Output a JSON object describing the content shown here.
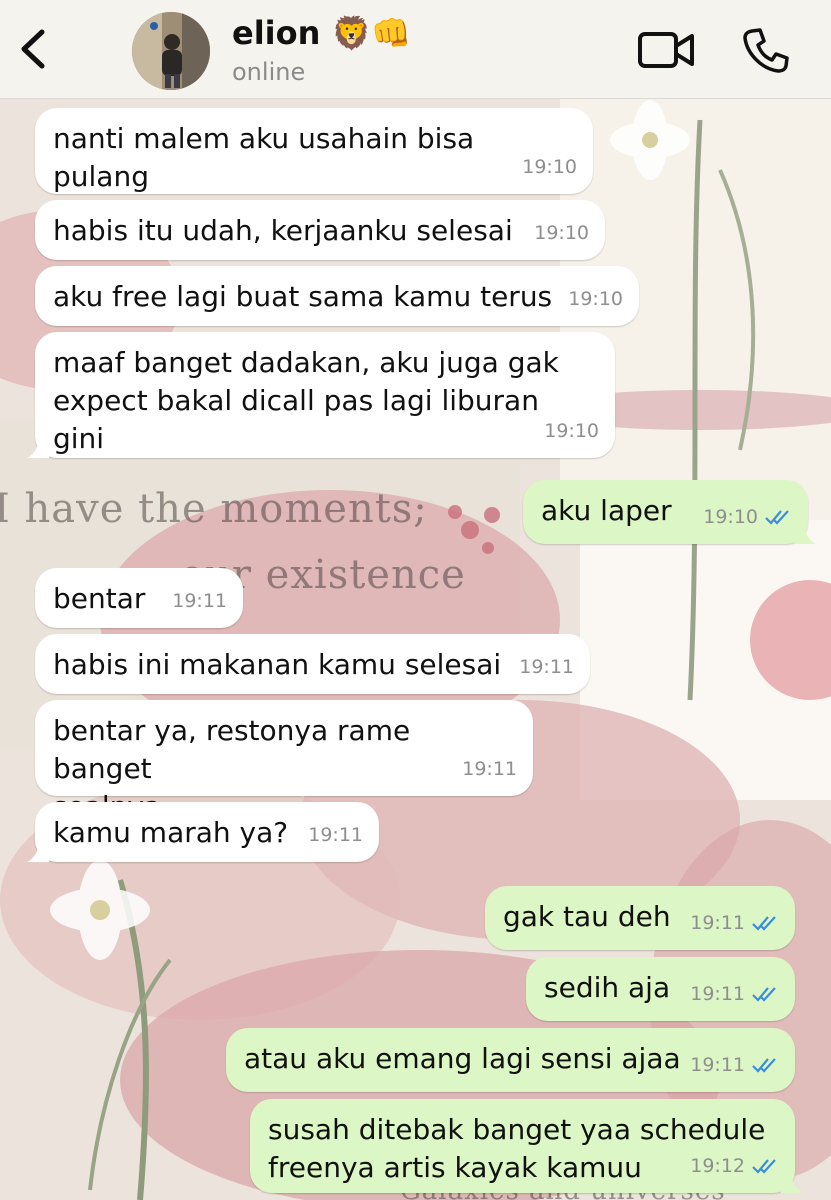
{
  "header": {
    "contact_name": "elion 🦁👊",
    "status": "online"
  },
  "colors": {
    "incoming_bubble": "#ffffff",
    "outgoing_bubble": "#dcf7c5",
    "read_tick": "#3c8ddc",
    "header_bg": "#f4f3ee"
  },
  "icons": {
    "back": "chevron-left-icon",
    "video": "video-camera-icon",
    "call": "phone-icon",
    "read": "double-check-icon"
  },
  "messages": [
    {
      "dir": "in",
      "text": "nanti malem aku usahain bisa pulang",
      "time": "19:10"
    },
    {
      "dir": "in",
      "text": "habis itu udah, kerjaanku selesai",
      "time": "19:10"
    },
    {
      "dir": "in",
      "text": "aku free lagi buat sama kamu terus",
      "time": "19:10"
    },
    {
      "dir": "in",
      "text": "maaf banget dadakan, aku juga gak\nexpect bakal dicall pas lagi liburan gini",
      "time": "19:10"
    },
    {
      "dir": "out",
      "text": "aku laper",
      "time": "19:10",
      "read": true
    },
    {
      "dir": "in",
      "text": "bentar",
      "time": "19:11"
    },
    {
      "dir": "in",
      "text": "habis ini makanan kamu selesai",
      "time": "19:11"
    },
    {
      "dir": "in",
      "text": "bentar ya, restonya rame banget\nsoalnya",
      "time": "19:11"
    },
    {
      "dir": "in",
      "text": "kamu marah ya?",
      "time": "19:11"
    },
    {
      "dir": "out",
      "text": "gak tau deh",
      "time": "19:11",
      "read": true
    },
    {
      "dir": "out",
      "text": "sedih aja",
      "time": "19:11",
      "read": true
    },
    {
      "dir": "out",
      "text": "atau aku emang lagi sensi ajaa",
      "time": "19:11",
      "read": true
    },
    {
      "dir": "out",
      "text": "susah ditebak banget yaa schedule\nfreenya artis kayak kamuu",
      "time": "19:12",
      "read": true
    }
  ],
  "wallpaper": {
    "lines": [
      "I have the moments;",
      "our existence",
      "Galaxies and universes"
    ]
  }
}
